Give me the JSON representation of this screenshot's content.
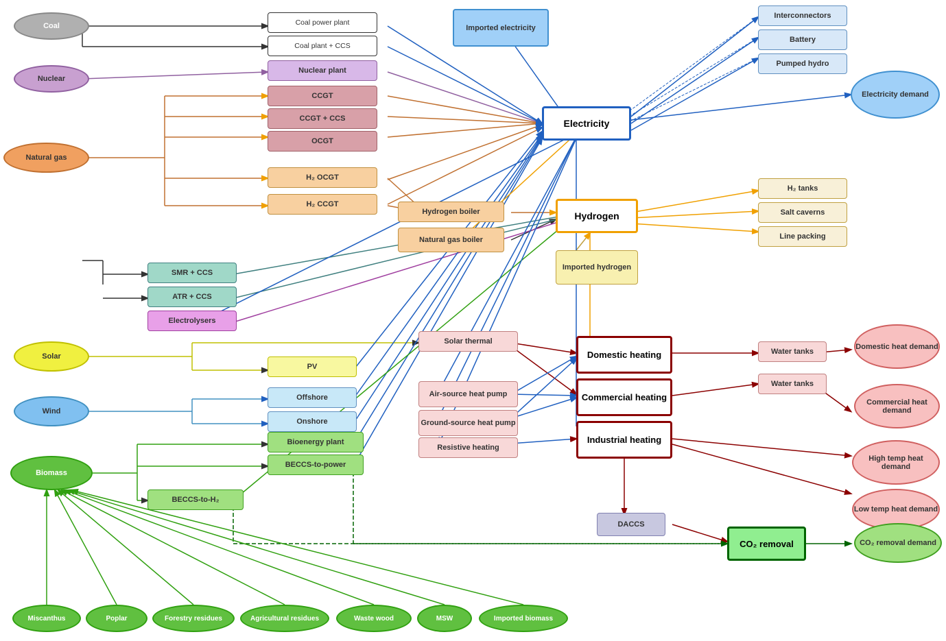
{
  "nodes": {
    "coal": "Coal",
    "nuclear": "Nuclear",
    "natgas": "Natural gas",
    "solar": "Solar",
    "wind": "Wind",
    "biomass": "Biomass",
    "coal_power_plant": "Coal power plant",
    "coal_plant_ccs": "Coal plant + CCS",
    "nuclear_plant": "Nuclear plant",
    "ccgt": "CCGT",
    "ccgt_ccs": "CCGT + CCS",
    "ocgt": "OCGT",
    "h2_ocgt": "H₂ OCGT",
    "h2_ccgt": "H₂ CCGT",
    "hydrogen_boiler": "Hydrogen boiler",
    "natgas_boiler": "Natural gas boiler",
    "smr_ccs": "SMR + CCS",
    "atr_ccs": "ATR + CCS",
    "electrolysers": "Electrolysers",
    "solar_thermal": "Solar thermal",
    "pv": "PV",
    "offshore": "Offshore",
    "onshore": "Onshore",
    "bioenergy_plant": "Bioenergy plant",
    "beccs_power": "BECCS-to-power",
    "beccs_h2": "BECCS-to-H₂",
    "air_source_hp": "Air-source heat pump",
    "ground_source_hp": "Ground-source heat pump",
    "resistive_heating": "Resistive heating",
    "electricity": "Electricity",
    "hydrogen": "Hydrogen",
    "domestic_heating": "Domestic heating",
    "commercial_heating": "Commercial heating",
    "industrial_heating": "Industrial heating",
    "co2_removal": "CO₂ removal",
    "daccs": "DACCS",
    "imported_electricity": "Imported electricity",
    "imported_hydrogen": "Imported hydrogen",
    "interconnectors": "Interconnectors",
    "battery": "Battery",
    "pumped_hydro": "Pumped hydro",
    "h2_tanks": "H₂ tanks",
    "salt_caverns": "Salt caverns",
    "line_packing": "Line packing",
    "water_tanks_dom": "Water tanks",
    "water_tanks_com": "Water tanks",
    "electricity_demand": "Electricity demand",
    "domestic_heat_demand": "Domestic heat demand",
    "commercial_heat_demand": "Commercial heat demand",
    "high_temp_heat_demand": "High temp heat demand",
    "low_temp_heat_demand": "Low temp heat demand",
    "co2_removal_demand": "CO₂ removal demand",
    "miscanthus": "Miscanthus",
    "poplar": "Poplar",
    "forestry_residues": "Forestry residues",
    "agricultural_residues": "Agricultural residues",
    "waste_wood": "Waste wood",
    "msw": "MSW",
    "imported_biomass": "Imported biomass"
  }
}
